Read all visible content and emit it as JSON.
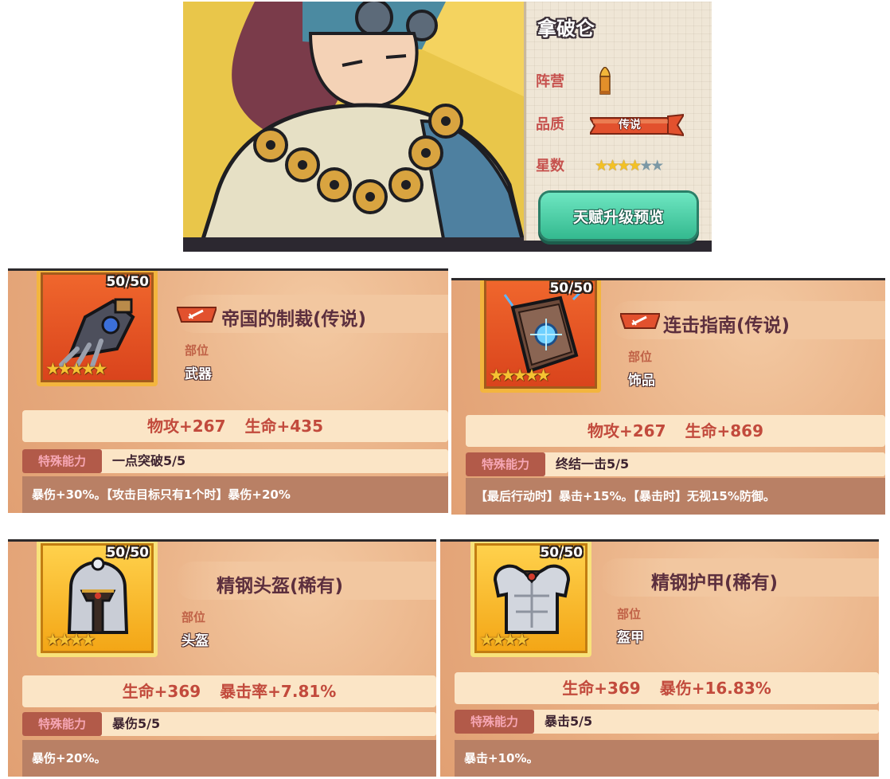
{
  "hero": {
    "name": "拿破仑",
    "faction_label": "阵营",
    "quality_label": "品质",
    "quality_value": "传说",
    "stars_label": "星数",
    "stars": {
      "filled": 4,
      "total": 6
    },
    "talent_button": "天赋升级预览"
  },
  "equipment": [
    {
      "level": "50/50",
      "frame": "red",
      "stars": "★★★★★",
      "title": "帝国的制裁(传说)",
      "part_label": "部位",
      "part_value": "武器",
      "stat1": "物攻+267",
      "stat2": "生命+435",
      "ability_label": "特殊能力",
      "ability_name": "一点突破5/5",
      "description": "暴伤+30%。【攻击目标只有1个时】暴伤+20%"
    },
    {
      "level": "50/50",
      "frame": "red",
      "stars": "★★★★★",
      "title": "连击指南(传说)",
      "part_label": "部位",
      "part_value": "饰品",
      "stat1": "物攻+267",
      "stat2": "生命+869",
      "ability_label": "特殊能力",
      "ability_name": "终结一击5/5",
      "description": "【最后行动时】暴击+15%。【暴击时】无视15%防御。"
    },
    {
      "level": "50/50",
      "frame": "gold",
      "stars": "★★★★",
      "title": "精钢头盔(稀有)",
      "part_label": "部位",
      "part_value": "头盔",
      "stat1": "生命+369",
      "stat2": "暴击率+7.81%",
      "ability_label": "特殊能力",
      "ability_name": "暴伤5/5",
      "description": "暴伤+20%。"
    },
    {
      "level": "50/50",
      "frame": "gold",
      "stars": "★★★★",
      "title": "精钢护甲(稀有)",
      "part_label": "部位",
      "part_value": "盔甲",
      "stat1": "生命+369",
      "stat2": "暴伤+16.83%",
      "ability_label": "特殊能力",
      "ability_name": "暴击5/5",
      "description": "暴击+10%。"
    }
  ],
  "icons": {
    "faction": "bullet-icon",
    "weapon_tag": "sword-tag-icon",
    "equip_1": "claw-gauntlet-icon",
    "equip_2": "spellbook-icon",
    "equip_3": "steel-helmet-icon",
    "equip_4": "steel-armor-icon"
  },
  "colors": {
    "title_text": "#5c2f3e",
    "stat_text": "#c24a3c",
    "ability_tag_bg": "#b25a49",
    "talent_button": "#45c79c"
  }
}
